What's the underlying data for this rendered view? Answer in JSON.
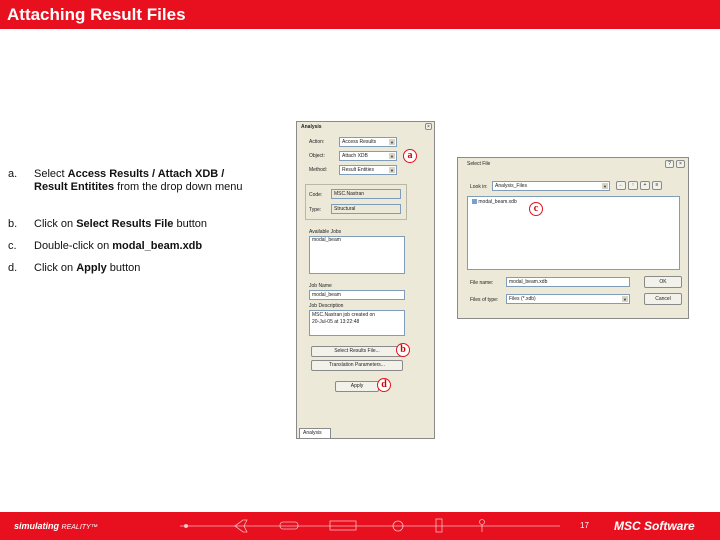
{
  "header": {
    "title": "Attaching Result Files"
  },
  "steps": [
    {
      "letter": "a.",
      "text_pre": "Select ",
      "bold1": "Access Results / Attach XDB /",
      "bold2": "Result Entitites",
      "text_post": " from the drop down menu"
    },
    {
      "letter": "b.",
      "text_pre": "Click on ",
      "bold": "Select Results File",
      "text_post": " button"
    },
    {
      "letter": "c.",
      "text_pre": "Double-click on ",
      "bold": "modal_beam.xdb",
      "text_post": ""
    },
    {
      "letter": "d.",
      "text_pre": "Click on ",
      "bold": "Apply",
      "text_post": " button"
    }
  ],
  "analysis_panel": {
    "title": "Analysis",
    "action_label": "Action:",
    "action_value": "Access Results",
    "object_label": "Object:",
    "object_value": "Attach XDB",
    "method_label": "Method:",
    "method_value": "Result Entities",
    "code_label": "Code:",
    "code_value": "MSC.Nastran",
    "type_label": "Type:",
    "type_value": "Structural",
    "available_jobs_label": "Available Jobs",
    "available_jobs_items": [
      "modal_beam"
    ],
    "job_name_label": "Job Name",
    "job_name_value": "modal_beam",
    "job_desc_label": "Job Description",
    "job_desc_line1": "MSC.Nastran job created on",
    "job_desc_line2": "20-Jul-05 at 13:22:48",
    "select_results_button": "Select Results File...",
    "translation_params_button": "Translation Parameters...",
    "apply_button": "Apply",
    "tab_label": "Analysis"
  },
  "file_dialog": {
    "title": "Select File",
    "look_in_label": "Look in:",
    "look_in_value": "Analysis_Files",
    "file_item": "modal_beam.xdb",
    "file_name_label": "File name:",
    "file_name_value": "modal_beam.xdb",
    "file_type_label": "Files of type:",
    "file_type_value": "Files (*.xdb)",
    "ok_button": "OK",
    "cancel_button": "Cancel"
  },
  "markers": {
    "a": "a",
    "b": "b",
    "c": "c",
    "d": "d"
  },
  "footer": {
    "slogan_bold": "simulating",
    "slogan_rest": "REALITY™",
    "page_number": "17",
    "logo": "MSC Software"
  },
  "colors": {
    "brand_red": "#e8101e",
    "window_bg": "#ece9d8",
    "marker_red": "#cc0000"
  }
}
